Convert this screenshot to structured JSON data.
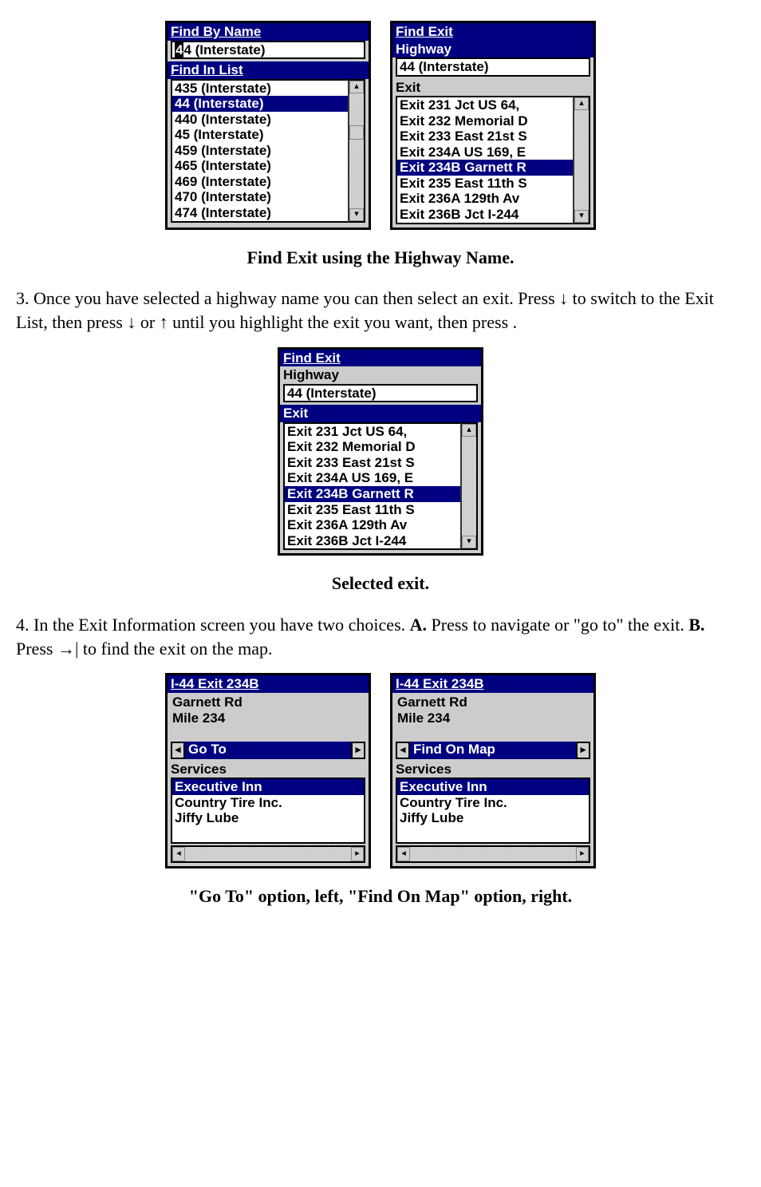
{
  "figure1": {
    "left": {
      "title1": "Find By Name",
      "input1_cursor": "4",
      "input1_rest": "4 (Interstate)",
      "title2": "Find In List",
      "list": [
        {
          "text": "435 (Interstate)",
          "selected": false
        },
        {
          "text": "44 (Interstate)",
          "selected": true
        },
        {
          "text": "440 (Interstate)",
          "selected": false
        },
        {
          "text": "45 (Interstate)",
          "selected": false
        },
        {
          "text": "459 (Interstate)",
          "selected": false
        },
        {
          "text": "465 (Interstate)",
          "selected": false
        },
        {
          "text": "469 (Interstate)",
          "selected": false
        },
        {
          "text": "470 (Interstate)",
          "selected": false
        },
        {
          "text": "474 (Interstate)",
          "selected": false
        }
      ]
    },
    "right": {
      "title": "Find Exit",
      "hwlabel": "Highway",
      "hwvalue": "44 (Interstate)",
      "exitlabel": "Exit",
      "list": [
        {
          "text": "Exit 231 Jct US 64,",
          "selected": false
        },
        {
          "text": "Exit 232 Memorial D",
          "selected": false
        },
        {
          "text": "Exit 233 East 21st S",
          "selected": false
        },
        {
          "text": "Exit 234A US 169, E",
          "selected": false
        },
        {
          "text": "Exit 234B Garnett R",
          "selected": true
        },
        {
          "text": "Exit 235 East 11th S",
          "selected": false
        },
        {
          "text": "Exit 236A 129th Av",
          "selected": false
        },
        {
          "text": "Exit 236B Jct I-244",
          "selected": false
        }
      ]
    },
    "caption": "Find Exit using the Highway Name."
  },
  "para1": "3. Once you have selected a highway name you can then select an exit. Press ↓ to switch to the Exit List, then press ↓ or ↑ until you highlight the exit you want, then press       .",
  "figure2": {
    "title": "Find Exit",
    "hwlabel": "Highway",
    "hwvalue": "44 (Interstate)",
    "exitlabel": "Exit",
    "list": [
      {
        "text": "Exit 231 Jct US 64,",
        "selected": false
      },
      {
        "text": "Exit 232 Memorial D",
        "selected": false
      },
      {
        "text": "Exit 233 East 21st S",
        "selected": false
      },
      {
        "text": "Exit 234A US 169, E",
        "selected": false
      },
      {
        "text": "Exit 234B Garnett R",
        "selected": true
      },
      {
        "text": "Exit 235 East 11th S",
        "selected": false
      },
      {
        "text": "Exit 236A 129th Av",
        "selected": false
      },
      {
        "text": "Exit 236B Jct I-244",
        "selected": false
      }
    ],
    "caption": "Selected exit."
  },
  "para2a": "4. In the Exit Information screen you have two choices. ",
  "para2b": "A.",
  "para2c": " Press        to navigate or \"go to\" the exit. ",
  "para2d": "B.",
  "para2e": " Press →|        to find the exit on the map.",
  "figure3": {
    "left": {
      "title": "I-44 Exit 234B",
      "line1": "Garnett Rd",
      "line2": "Mile 234",
      "action": "Go To",
      "svclabel": "Services",
      "services": [
        {
          "text": "Executive Inn",
          "selected": true
        },
        {
          "text": "Country Tire Inc.",
          "selected": false
        },
        {
          "text": "Jiffy Lube",
          "selected": false
        }
      ]
    },
    "right": {
      "title": "I-44 Exit 234B",
      "line1": "Garnett Rd",
      "line2": "Mile 234",
      "action": "Find On Map",
      "svclabel": "Services",
      "services": [
        {
          "text": "Executive Inn",
          "selected": true
        },
        {
          "text": "Country Tire Inc.",
          "selected": false
        },
        {
          "text": "Jiffy Lube",
          "selected": false
        }
      ]
    },
    "caption": "\"Go To\" option, left, \"Find On Map\" option, right."
  }
}
